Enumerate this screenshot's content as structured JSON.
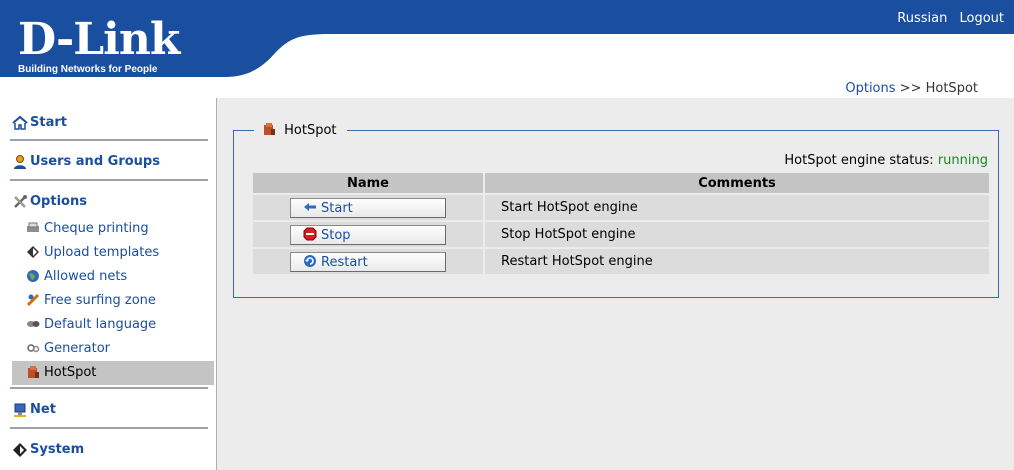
{
  "header": {
    "brand": "D-Link",
    "tagline": "Building Networks for People",
    "links": [
      "Russian",
      "Logout"
    ],
    "brand_color": "#1a4fa0"
  },
  "breadcrumb": {
    "parent": "Options",
    "separator": ">>",
    "current": "HotSpot"
  },
  "sidebar": {
    "sections": [
      {
        "label": "Start",
        "icon": "home-icon"
      },
      {
        "label": "Users and Groups",
        "icon": "users-icon"
      },
      {
        "label": "Options",
        "icon": "tools-icon",
        "items": [
          {
            "label": "Cheque printing",
            "icon": "printer-icon"
          },
          {
            "label": "Upload templates",
            "icon": "upload-icon"
          },
          {
            "label": "Allowed nets",
            "icon": "globe-icon"
          },
          {
            "label": "Free surfing zone",
            "icon": "surf-icon"
          },
          {
            "label": "Default language",
            "icon": "language-icon"
          },
          {
            "label": "Generator",
            "icon": "generator-icon"
          },
          {
            "label": "HotSpot",
            "icon": "hotspot-icon",
            "active": true
          }
        ]
      },
      {
        "label": "Net",
        "icon": "network-icon"
      },
      {
        "label": "System",
        "icon": "system-icon"
      }
    ]
  },
  "panel": {
    "legend": "HotSpot",
    "status_label": "HotSpot engine status:",
    "status_value": "running",
    "columns": [
      "Name",
      "Comments"
    ],
    "rows": [
      {
        "button": "Start",
        "icon": "start-arrow-icon",
        "comment": "Start HotSpot engine"
      },
      {
        "button": "Stop",
        "icon": "stop-sign-icon",
        "comment": "Stop HotSpot engine"
      },
      {
        "button": "Restart",
        "icon": "restart-icon",
        "comment": "Restart HotSpot engine"
      }
    ]
  }
}
